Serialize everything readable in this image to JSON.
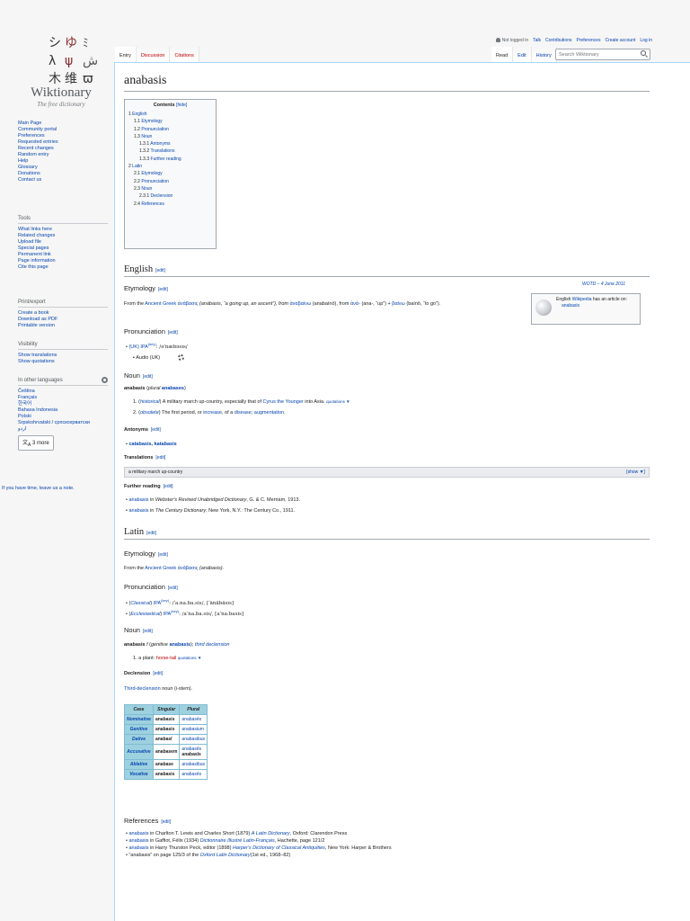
{
  "personal": {
    "not_logged_in": "Not logged in",
    "links": [
      "Talk",
      "Contributions",
      "Preferences",
      "Create account",
      "Log in"
    ]
  },
  "tabs_left": [
    "Entry",
    "Discussion",
    "Citations"
  ],
  "tabs_right": [
    "Read",
    "Edit",
    "History"
  ],
  "search": {
    "placeholder": "Search Wiktionary"
  },
  "logo": {
    "wordmark": "Wiktionary",
    "tagline": "The free dictionary"
  },
  "sidebar": {
    "nav": [
      "Main Page",
      "Community portal",
      "Preferences",
      "Requested entries",
      "Recent changes",
      "Random entry",
      "Help",
      "Glossary",
      "Donations",
      "Contact us"
    ],
    "tools_header": "Tools",
    "tools": [
      "What links here",
      "Related changes",
      "Upload file",
      "Special pages",
      "Permanent link",
      "Page information",
      "Cite this page"
    ],
    "print_header": "Print/export",
    "print": [
      "Create a book",
      "Download as PDF",
      "Printable version"
    ],
    "vis_header": "Visibility",
    "vis": [
      "Show translations",
      "Show quotations"
    ],
    "lang_header": "In other languages",
    "langs": [
      "Čeština",
      "Français",
      "한국어",
      "Bahasa Indonesia",
      "Polski",
      "Srpskohrvatski / српскохрватски",
      "اردو"
    ],
    "more_langs": "3 more",
    "leave_note": "If you have time, leave us a note."
  },
  "page": {
    "title": "anabasis",
    "edit_label": "[edit]",
    "toc": {
      "title": "Contents",
      "hide": "[hide]",
      "entries": [
        {
          "num": "1",
          "text": "English",
          "level": 0
        },
        {
          "num": "1.1",
          "text": "Etymology",
          "level": 1
        },
        {
          "num": "1.2",
          "text": "Pronunciation",
          "level": 1
        },
        {
          "num": "1.3",
          "text": "Noun",
          "level": 1
        },
        {
          "num": "1.3.1",
          "text": "Antonyms",
          "level": 2
        },
        {
          "num": "1.3.2",
          "text": "Translations",
          "level": 2
        },
        {
          "num": "1.3.3",
          "text": "Further reading",
          "level": 2
        },
        {
          "num": "2",
          "text": "Latin",
          "level": 0
        },
        {
          "num": "2.1",
          "text": "Etymology",
          "level": 1
        },
        {
          "num": "2.2",
          "text": "Pronunciation",
          "level": 1
        },
        {
          "num": "2.3",
          "text": "Noun",
          "level": 1
        },
        {
          "num": "2.3.1",
          "text": "Declension",
          "level": 2
        },
        {
          "num": "2.4",
          "text": "References",
          "level": 1
        }
      ]
    },
    "english": {
      "heading": "English",
      "wotd": "WOTD – 4 June 2011",
      "wp_box": {
        "line1": "English",
        "link": "Wikipedia",
        "line2": "has an article on:",
        "article": "anabasis"
      },
      "etym_heading": "Etymology",
      "etym": {
        "t1": "From the",
        "lang": "Ancient Greek",
        "greek": "ἀνάβασις",
        "t2": "(anábasis, “a going up, an ascent”), from",
        "greek2": "ἀναβαίνω",
        "t3": "(anabaínō), from",
        "greek3": "ἀνά-",
        "t4": "(ana-, “up”) +",
        "greek4": "βαίνω",
        "t5": "(baínō, “to go”)."
      },
      "pron_heading": "Pronunciation",
      "pron_rp": "(UK)",
      "pron_ipa_link": "IPA",
      "pron_key": "(key)",
      "pron_ipa": ": /əˈnæbəsɪs/",
      "audio_label": "Audio (UK)",
      "noun_heading": "Noun",
      "noun_head": "anabasis",
      "noun_plural_label": "plural",
      "noun_plural": "anabases",
      "sense1_tag": "historical",
      "sense1_text": "A military march up-country, especially that of",
      "sense1_link": "Cyrus the Younger",
      "sense1_tail": "into Asia.",
      "quotations": "quotations ▼",
      "sense2_tag": "obsolete",
      "sense2_text": "The first period, or",
      "sense2_link1": "increase",
      "sense2_mid": ", of a",
      "sense2_link2": "disease",
      "sense2_sep": ";",
      "sense2_link3": "augmentation",
      "ant_heading": "Antonyms",
      "ant_links": "catabasis, katabasis",
      "trans_heading": "Translations",
      "trans_bar": "a military march up-country",
      "trans_show": "[show ▼]",
      "fr_heading": "Further reading",
      "fr1_link": "anabasis",
      "fr1_in": "in",
      "fr1_title": "Webster's Revised Unabridged Dictionary",
      "fr1_tail": ", G. & C. Merriam, 1913.",
      "fr2_link": "anabasis",
      "fr2_in": "in",
      "fr2_title": "The Century Dictionary",
      "fr2_tail": ", New York, N.Y.: The Century Co., 1911."
    },
    "latin": {
      "heading": "Latin",
      "etym_heading": "Etymology",
      "etym_t1": "From the",
      "etym_lang": "Ancient Greek",
      "etym_greek": "ἀνάβασις",
      "etym_tail": "(anábasis).",
      "pron_heading": "Pronunciation",
      "pron1_tag": "Classical",
      "pron1_ipa": ": /ˈa.na.ba.sis/, [ˈänäbäsɪs]",
      "pron2_tag": "Ecclesiastical",
      "pron2_ipa": ": /aˈna.ba.sis/, [aˈnaːbasis]",
      "ipa_label": "IPA",
      "key": "(key)",
      "noun_heading": "Noun",
      "noun_head": "anabasis",
      "noun_gender": "f",
      "noun_gen_label": "genitive",
      "noun_gen": "anabasis",
      "noun_decl": "third declension",
      "sense1_a": "a plant:",
      "sense1_link": "horse-tail",
      "quotations": "quotations ▼",
      "decl_heading": "Declension",
      "decl_link": "Third-declension",
      "decl_tail": "noun (i-stem).",
      "table": {
        "headers": [
          "Case",
          "Singular",
          "Plural"
        ],
        "rows": [
          {
            "case": "Nominative",
            "sg": "anabasis",
            "pl": "anabasēs"
          },
          {
            "case": "Genitive",
            "sg": "anabasis",
            "pl": "anabasium"
          },
          {
            "case": "Dative",
            "sg": "anabasī",
            "pl": "anabasibus"
          },
          {
            "case": "Accusative",
            "sg": "anabasem",
            "pl": "anabasēs",
            "pl2": "anabasīs"
          },
          {
            "case": "Ablative",
            "sg": "anabase",
            "pl": "anabasibus"
          },
          {
            "case": "Vocative",
            "sg": "anabasis",
            "pl": "anabasēs"
          }
        ]
      },
      "ref_heading": "References",
      "refs": [
        {
          "link": "anabasis",
          "t": "in Charlton T. Lewis and Charles Short (1879)",
          "title": "A Latin Dictionary",
          "tail": ", Oxford: Clarendon Press"
        },
        {
          "link": "anabasis",
          "t": "in Gaffiot, Félix (1934)",
          "title": "Dictionnaire Illustré Latin-Français",
          "tail": ", Hachette, page 121/2"
        },
        {
          "link": "anabasis",
          "t": "in Harry Thurston Peck, editor (1898)",
          "title": "Harper's Dictionary of Classical Antiquities",
          "tail": ", New York: Harper & Brothers"
        },
        {
          "link": "",
          "t": "“anabasis” on page 125/3 of the",
          "title": "Oxford Latin Dictionary",
          "tail": "(1st ed., 1968–82)"
        }
      ]
    }
  }
}
